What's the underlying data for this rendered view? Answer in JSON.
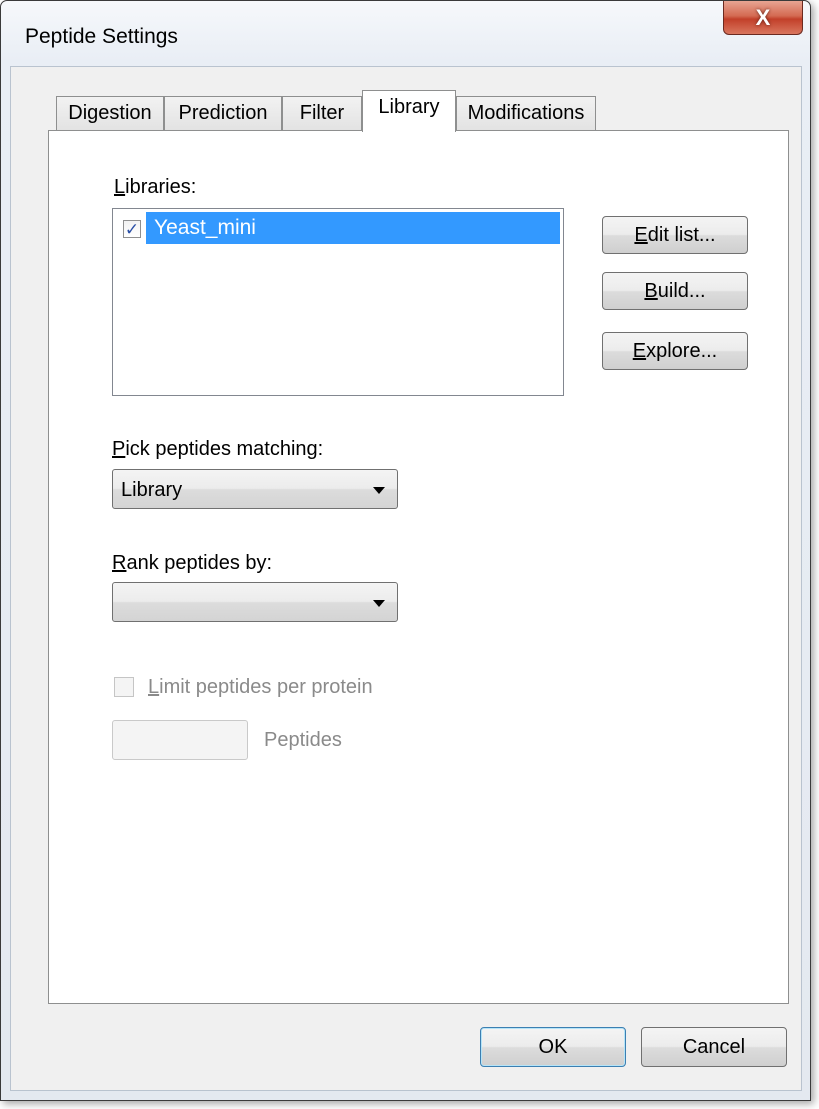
{
  "window": {
    "title": "Peptide Settings",
    "close_glyph": "X"
  },
  "tabs": [
    {
      "label": "Digestion",
      "active": false
    },
    {
      "label": "Prediction",
      "active": false
    },
    {
      "label": "Filter",
      "active": false
    },
    {
      "label": "Library",
      "active": true
    },
    {
      "label": "Modifications",
      "active": false
    }
  ],
  "library": {
    "libraries_label_first": "L",
    "libraries_label_rest": "ibraries:",
    "items": [
      {
        "name": "Yeast_mini",
        "checked": true,
        "selected": true
      }
    ],
    "check_glyph": "✓",
    "edit_list": {
      "mnemonic": "E",
      "rest": "dit list..."
    },
    "build": {
      "mnemonic": "B",
      "rest": "uild..."
    },
    "explore": {
      "mnemonic": "E",
      "rest": "xplore..."
    },
    "pick_label_first": "P",
    "pick_label_rest": "ick peptides matching:",
    "pick_value": "Library",
    "rank_label_first": "R",
    "rank_label_rest": "ank peptides by:",
    "rank_value": "",
    "limit_label_first": "L",
    "limit_label_rest": "imit peptides per protein",
    "limit_checked": false,
    "limit_value": "",
    "peptides_unit": "Peptides"
  },
  "footer": {
    "ok_label": "OK",
    "cancel_label": "Cancel"
  },
  "colors": {
    "selection": "#3399ff",
    "close_button": "#c2402a",
    "default_button_border": "#3c7fb1"
  }
}
